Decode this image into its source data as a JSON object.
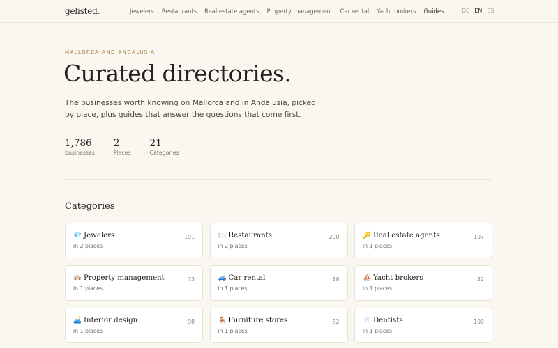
{
  "header": {
    "logo": "gelisted.",
    "nav": [
      {
        "label": "Jewelers",
        "active": false
      },
      {
        "label": "Restaurants",
        "active": false
      },
      {
        "label": "Real estate agents",
        "active": false
      },
      {
        "label": "Property management",
        "active": false
      },
      {
        "label": "Car rental",
        "active": false
      },
      {
        "label": "Yacht brokers",
        "active": false
      },
      {
        "label": "Guides",
        "active": true
      }
    ],
    "languages": [
      {
        "label": "DE",
        "active": false
      },
      {
        "label": "EN",
        "active": true
      },
      {
        "label": "ES",
        "active": false
      }
    ]
  },
  "hero": {
    "kicker": "MALLORCA AND ANDALUSIA",
    "title": "Curated directories.",
    "lead": "The businesses worth knowing on Mallorca and in Andalusia, picked by place, plus guides that answer the questions that come first."
  },
  "stats": [
    {
      "value": "1,786",
      "label": "businesses"
    },
    {
      "value": "2",
      "label": "Places"
    },
    {
      "value": "21",
      "label": "Categories"
    }
  ],
  "categories": {
    "title": "Categories",
    "items": [
      {
        "icon": "💎",
        "icon_name": "gem-icon",
        "name": "Jewelers",
        "count": "191",
        "sub": "in 2 places"
      },
      {
        "icon": "🍽️",
        "icon_name": "plate-cutlery-icon",
        "name": "Restaurants",
        "count": "200",
        "sub": "in 2 places"
      },
      {
        "icon": "🔑",
        "icon_name": "key-icon",
        "name": "Real estate agents",
        "count": "107",
        "sub": "in 1 places"
      },
      {
        "icon": "🏘️",
        "icon_name": "houses-icon",
        "name": "Property management",
        "count": "73",
        "sub": "in 1 places"
      },
      {
        "icon": "🚙",
        "icon_name": "car-icon",
        "name": "Car rental",
        "count": "88",
        "sub": "in 1 places"
      },
      {
        "icon": "⛵",
        "icon_name": "sailboat-icon",
        "name": "Yacht brokers",
        "count": "32",
        "sub": "in 1 places"
      },
      {
        "icon": "🛋️",
        "icon_name": "couch-icon",
        "name": "Interior design",
        "count": "98",
        "sub": "in 1 places"
      },
      {
        "icon": "🪑",
        "icon_name": "chair-icon",
        "name": "Furniture stores",
        "count": "82",
        "sub": "in 1 places"
      },
      {
        "icon": "🦷",
        "icon_name": "tooth-icon",
        "name": "Dentists",
        "count": "100",
        "sub": "in 1 places"
      }
    ]
  }
}
